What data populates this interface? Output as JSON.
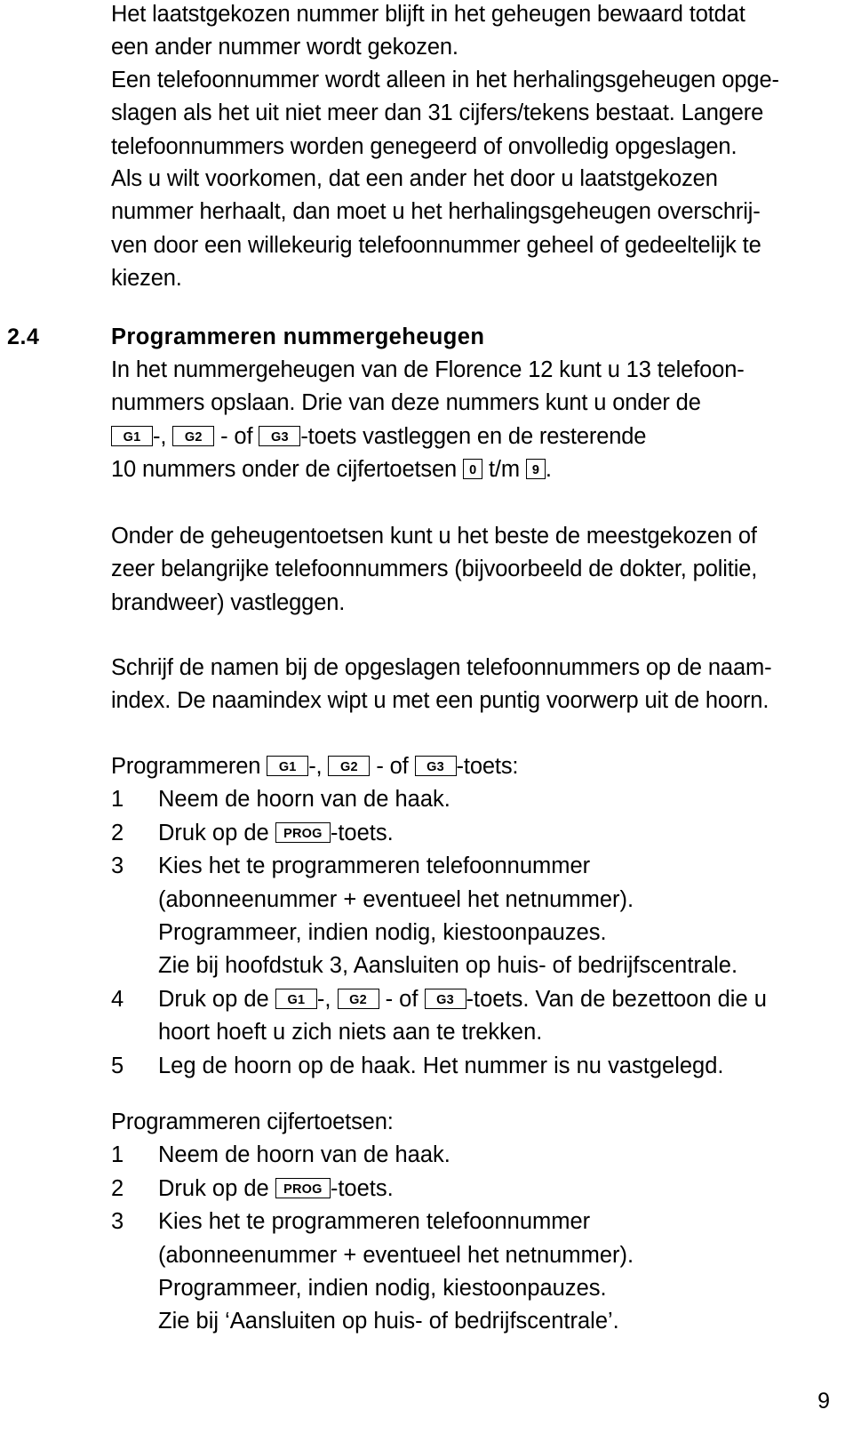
{
  "document": {
    "page_number": "9",
    "language": "nl"
  },
  "intro": {
    "para1": [
      "Het laatstgekozen nummer blijft in het geheugen bewaard totdat",
      "een ander nummer wordt gekozen."
    ],
    "para2": [
      "Een telefoonnummer wordt alleen in het herhalingsgeheugen opge-",
      "slagen als het uit niet meer dan 31 cijfers/tekens bestaat. Langere",
      "telefoonnummers worden genegeerd of onvolledig opgeslagen."
    ],
    "para3": [
      "Als u wilt voorkomen, dat een ander het door u laatstgekozen",
      "nummer herhaalt, dan moet u het herhalingsgeheugen overschrij-",
      "ven door een willekeurig telefoonnummer geheel of gedeeltelijk te",
      "kiezen."
    ]
  },
  "section": {
    "number": "2.4",
    "title": "Programmeren nummergeheugen",
    "body": {
      "line1": "In het nummergeheugen van de Florence 12 kunt u 13 telefoon-",
      "line2": "nummers opslaan. Drie van deze nummers kunt u onder de",
      "line3_after_g1": "-,",
      "line3_after_g2": "- of",
      "line3_after_g3": "-toets vastleggen en de resterende",
      "line4_prefix": "10 nummers onder de cijfertoetsen",
      "line4_mid": "t/m",
      "line4_suffix": "."
    }
  },
  "keys": {
    "g1": "G1",
    "g2": "G2",
    "g3": "G3",
    "prog": "PROG",
    "digit0": "0",
    "digit9": "9"
  },
  "para_memory": [
    "Onder de geheugentoetsen kunt u het beste de meestgekozen of",
    "zeer belangrijke telefoonnummers (bijvoorbeeld de dokter, politie,",
    "brandweer) vastleggen."
  ],
  "para_index": [
    "Schrijf de namen bij de opgeslagen telefoonnummers op de naam-",
    "index. De naamindex wipt u met een puntig voorwerp uit de hoorn."
  ],
  "proc_g": {
    "heading_prefix": "Programmeren",
    "heading_after_g1": "-,",
    "heading_after_g2": "- of",
    "heading_after_g3": "-toets:",
    "steps": [
      {
        "num": "1",
        "text": "Neem de hoorn van de haak."
      },
      {
        "num": "2",
        "text_before_key": "Druk op de",
        "text_after_key": "-toets."
      },
      {
        "num": "3",
        "text": "Kies het te programmeren telefoonnummer"
      },
      {
        "num": "",
        "text": "(abonneenummer + eventueel het netnummer)."
      },
      {
        "num": "",
        "text": "Programmeer, indien nodig, kiestoonpauzes."
      },
      {
        "num": "",
        "text": "Zie bij hoofdstuk 3, Aansluiten op huis- of bedrijfscentrale."
      },
      {
        "num": "4",
        "text_before_key": "Druk op de",
        "text_after_g1": "-,",
        "text_after_g2": "- of",
        "text_after_g3": "-toets. Van de bezettoon die u"
      },
      {
        "num": "",
        "text": "hoort hoeft u zich niets aan te trekken."
      },
      {
        "num": "5",
        "text": "Leg de hoorn op de haak. Het nummer is nu vastgelegd."
      }
    ]
  },
  "proc_digits": {
    "heading": "Programmeren cijfertoetsen:",
    "steps": [
      {
        "num": "1",
        "text": "Neem de hoorn van de haak."
      },
      {
        "num": "2",
        "text_before_key": "Druk op de",
        "text_after_key": "-toets."
      },
      {
        "num": "3",
        "text": "Kies het te programmeren telefoonnummer"
      },
      {
        "num": "",
        "text": "(abonneenummer + eventueel het netnummer)."
      },
      {
        "num": "",
        "text": "Programmeer, indien nodig, kiestoonpauzes."
      },
      {
        "num": "",
        "text": "Zie bij ‘Aansluiten op huis- of bedrijfscentrale’."
      }
    ]
  }
}
